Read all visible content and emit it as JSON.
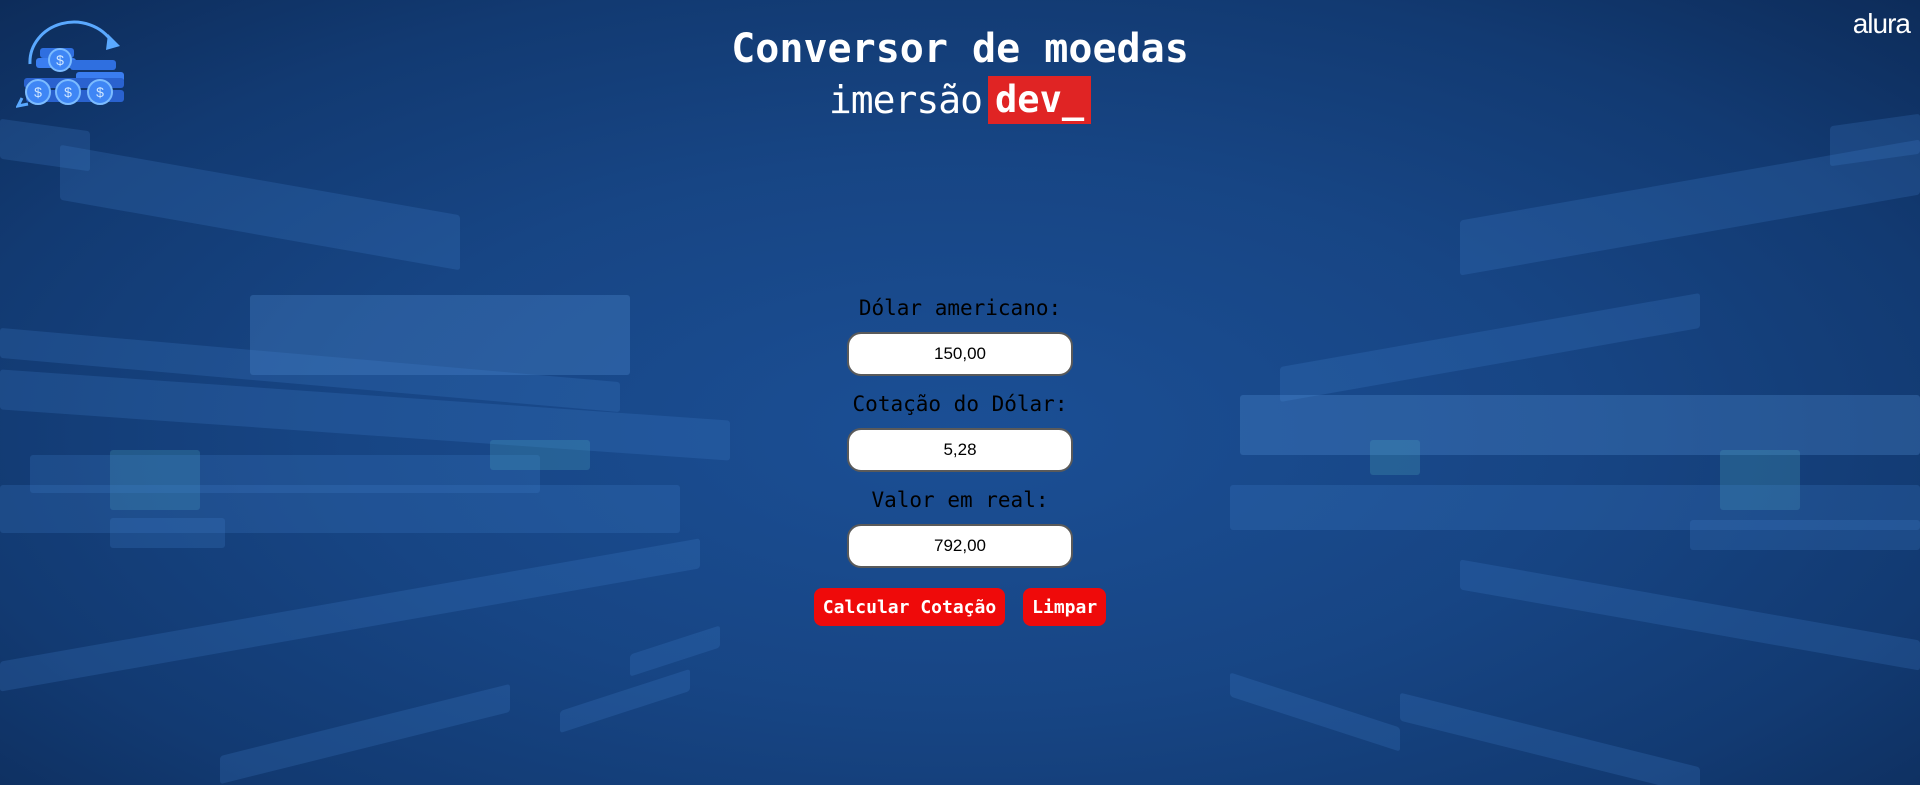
{
  "header": {
    "title": "Conversor de moedas",
    "subtitle_light": "imersão",
    "subtitle_tag": "dev_"
  },
  "brand": "alura",
  "logo_icon": "coins-exchange-icon",
  "form": {
    "dollar_label": "Dólar americano:",
    "dollar_value": "150,00",
    "rate_label": "Cotação do Dólar:",
    "rate_value": "5,28",
    "real_label": "Valor em real:",
    "real_value": "792,00"
  },
  "buttons": {
    "calculate_label": "Calcular Cotação",
    "clear_label": "Limpar"
  },
  "colors": {
    "accent_red": "#ef0a0a",
    "tag_red": "#e02424",
    "background_blue": "#174584"
  }
}
